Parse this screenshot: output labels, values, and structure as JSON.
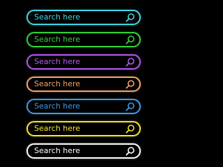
{
  "search_bars": [
    {
      "text": "Search here",
      "border_color": "#3fd8e6",
      "text_color": "#3fd8e6",
      "icon": "magnifier-icon"
    },
    {
      "text": "Search here",
      "border_color": "#35d43a",
      "text_color": "#35d43a",
      "icon": "magnifier-icon"
    },
    {
      "text": "Search here",
      "border_color": "#b558f0",
      "text_color": "#b558f0",
      "icon": "magnifier-icon"
    },
    {
      "text": "Search here",
      "border_color": "#f3a46b",
      "text_color": "#f3a46b",
      "icon": "magnifier-icon"
    },
    {
      "text": "Search here",
      "border_color": "#3e9be6",
      "text_color": "#3e9be6",
      "icon": "magnifier-icon"
    },
    {
      "text": "Search here",
      "border_color": "#f5e632",
      "text_color": "#f5e632",
      "icon": "magnifier-icon"
    },
    {
      "text": "Search here",
      "border_color": "#ffffff",
      "text_color": "#ffffff",
      "icon": "magnifier-icon"
    }
  ]
}
